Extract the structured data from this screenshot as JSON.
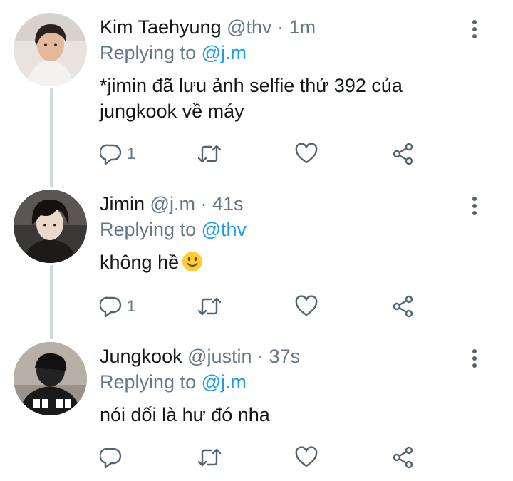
{
  "colors": {
    "text": "#14171a",
    "secondary": "#657786",
    "mention": "#1d9bf0",
    "icon": "#536471",
    "thread_line": "#cfd9de"
  },
  "tweets": [
    {
      "name": "Kim Taehyung",
      "handle": "@thv",
      "separator": "·",
      "time": "1m",
      "replying_label": "Replying to",
      "replying_to": "@j.m",
      "text": "*jimin đã lưu ảnh selfie thứ 392 của jungkook về máy",
      "reply_count": "1",
      "avatar_icon": "avatar-taehyung"
    },
    {
      "name": "Jimin",
      "handle": "@j.m",
      "separator": "·",
      "time": "41s",
      "replying_label": "Replying to",
      "replying_to": "@thv",
      "text": "không hề",
      "emoji": "slightly-smiling-face",
      "reply_count": "1",
      "avatar_icon": "avatar-jimin"
    },
    {
      "name": "Jungkook",
      "handle": "@justin",
      "separator": "·",
      "time": "37s",
      "replying_label": "Replying to",
      "replying_to": "@j.m",
      "text": "nói dối là hư đó nha",
      "reply_count": "",
      "avatar_icon": "avatar-jungkook"
    }
  ],
  "actions": [
    "reply-icon",
    "retweet-icon",
    "like-icon",
    "share-icon"
  ],
  "menu_icon": "more-vertical-icon"
}
